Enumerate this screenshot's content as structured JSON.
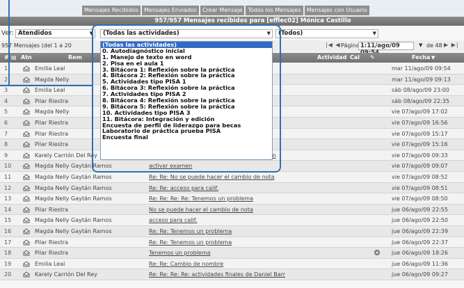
{
  "topnav": {
    "tabs": [
      "Mensajes Recibidos",
      "Mensajes Enviados",
      "Crear Mensaje",
      "Todos los Mensajes",
      "Mensajes con Usuario"
    ]
  },
  "titlebar": {
    "text": "957/957  Mensajes recibidos para [efflec02] Mónica Castillo"
  },
  "filters": {
    "ver_label": "Ver:",
    "status_value": "Atendidos",
    "activity_value": "(Todas las actividades)",
    "group_value": "(Todos)"
  },
  "paging": {
    "count_text": "957 Mensajes (del 1 a 20",
    "pagina_label": "Página",
    "page_value": "1:11/ago/09 09:54",
    "de_label": "de 48"
  },
  "table_header": {
    "num": "#",
    "atn": "Atn",
    "remitente": "Rem",
    "actividad": "Actividad",
    "cal": "Cal",
    "fecha": "Fecha"
  },
  "dropdown_options": [
    "(Todas las actividades)",
    "0. Autodiagnóstico inicial",
    "1. Manejo de texto en word",
    "2. Pisa en el aula 1",
    "3. Bitácora 1: Reflexión sobre la práctica",
    "4. Bitácora 2: Reflexión sobre la práctica",
    "5. Actividades tipo PISA 1",
    "6. Bitácora 3: Reflexión sobre la práctica",
    "7. Actividades tipo PISA 2",
    "8. Bitácora 4: Reflexión sobre la práctica",
    "9. Bitácora 5: Reflexión sobre la práctica",
    "10. Actividades tipo PISA 3",
    "11. Bitácora: Integración y edición",
    "Encuesta de perfil de liderazgo para becas",
    "Laboratorio de práctica prueba PISA",
    "Encuesta final"
  ],
  "rows": [
    {
      "num": "1",
      "sender": "Emilia Leal",
      "subject": "",
      "date": "mar 11/ago/09 09:54",
      "attach": false
    },
    {
      "num": "2",
      "sender": "Magda Nelly",
      "subject": "",
      "date": "mar 11/ago/09 09:13",
      "attach": false
    },
    {
      "num": "3",
      "sender": "Emilia Leal",
      "subject": "",
      "date": "sáb 08/ago/09 23:00",
      "attach": false
    },
    {
      "num": "4",
      "sender": "Pilar Riestra",
      "subject": "",
      "date": "sáb 08/ago/09 22:35",
      "attach": false
    },
    {
      "num": "5",
      "sender": "Magda Nelly",
      "subject": "",
      "date": "vie 07/ago/09 17:02",
      "attach": false
    },
    {
      "num": "6",
      "sender": "Pilar Riestra",
      "subject": "",
      "date": "vie 07/ago/09 16:56",
      "attach": false
    },
    {
      "num": "7",
      "sender": "Pilar Riestra",
      "subject": "",
      "date": "vie 07/ago/09 15:17",
      "attach": false
    },
    {
      "num": "8",
      "sender": "Pilar Riestra",
      "subject": "de nota",
      "date": "vie 07/ago/09 15:16",
      "attach": false
    },
    {
      "num": "9",
      "sender": "Karely Carrión Del Rey",
      "subject": "Re: Re: Re: Re: Re: actividades finales de Dan",
      "date": "vie 07/ago/09 09:33",
      "attach": false
    },
    {
      "num": "10",
      "sender": "Magda Nelly Gaytán Ramos",
      "subject": "activar examen",
      "date": "vie 07/ago/09 09:07",
      "attach": false
    },
    {
      "num": "11",
      "sender": "Magda Nelly Gaytán Ramos",
      "subject": "Re: Re: No se puede hacer el cambio de nota",
      "date": "vie 07/ago/09 08:52",
      "attach": false
    },
    {
      "num": "12",
      "sender": "Magda Nelly Gaytán Ramos",
      "subject": "Re: Re: acceso para calif.",
      "date": "vie 07/ago/09 08:51",
      "attach": false
    },
    {
      "num": "13",
      "sender": "Magda Nelly Gaytán Ramos",
      "subject": "Re: Re: Re: Re: Tenemos un problema",
      "date": "vie 07/ago/09 08:50",
      "attach": false
    },
    {
      "num": "14",
      "sender": "Pilar Riestra",
      "subject": "No se puede hacer el cambio de nota",
      "date": "jue 06/ago/09 22:55",
      "attach": false
    },
    {
      "num": "15",
      "sender": "Magda Nelly Gaytán Ramos",
      "subject": "acceso para calif.",
      "date": "jue 06/ago/09 22:50",
      "attach": false
    },
    {
      "num": "16",
      "sender": "Magda Nelly Gaytán Ramos",
      "subject": "Re: Re: Tenemos un problema",
      "date": "jue 06/ago/09 22:39",
      "attach": false
    },
    {
      "num": "17",
      "sender": "Pilar Riestra",
      "subject": "Re: Re: Tenemos un problema",
      "date": "jue 06/ago/09 22:37",
      "attach": false
    },
    {
      "num": "18",
      "sender": "Pilar Riestra",
      "subject": "Tenemos un problema",
      "date": "jue 06/ago/09 18:26",
      "attach": true
    },
    {
      "num": "19",
      "sender": "Emilia Leal",
      "subject": "Re: Re: Cambio de nombre",
      "date": "jue 06/ago/09 11:36",
      "attach": false
    },
    {
      "num": "20",
      "sender": "Karely Carrión Del Rey",
      "subject": "Re: Re: Re: Re: actividades finales de Daniel Barr",
      "date": "jue 06/ago/09 09:27",
      "attach": false
    }
  ]
}
